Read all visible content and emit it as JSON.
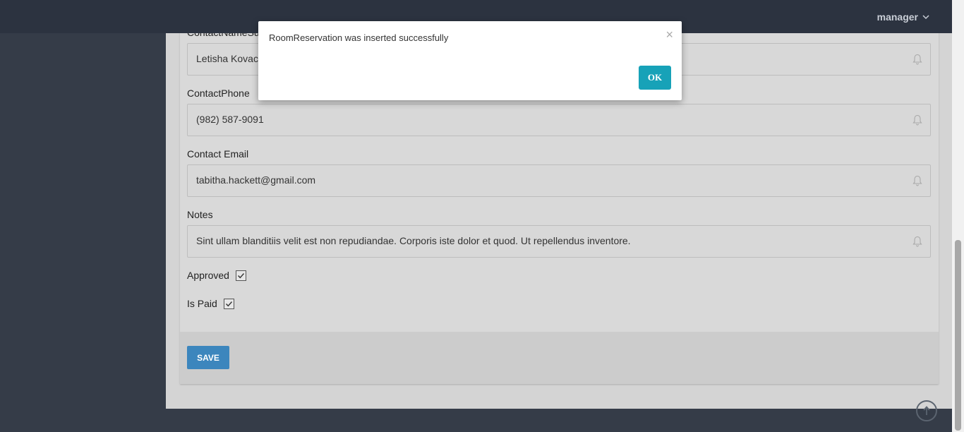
{
  "header": {
    "user_label": "manager"
  },
  "form": {
    "contact_name": {
      "label": "ContactNameSu",
      "value": "Letisha Kovac"
    },
    "contact_phone": {
      "label": "ContactPhone",
      "value": "(982) 587-9091"
    },
    "contact_email": {
      "label": "Contact Email",
      "value": "tabitha.hackett@gmail.com"
    },
    "notes": {
      "label": "Notes",
      "value": "Sint ullam blanditiis velit est non repudiandae. Corporis iste dolor et quod. Ut repellendus inventore."
    },
    "approved": {
      "label": "Approved",
      "checked": true
    },
    "is_paid": {
      "label": "Is Paid",
      "checked": true
    },
    "save_label": "SAVE"
  },
  "modal": {
    "message": "RoomReservation was inserted successfully",
    "close_glyph": "×",
    "ok_label": "OK"
  },
  "colors": {
    "accent": "#3c86bd",
    "ok": "#17a2b8",
    "sidebar": "#353c48",
    "topbar": "#2c3340"
  },
  "icons": [
    "chevron-down-icon",
    "bell-icon",
    "check-icon",
    "close-icon",
    "arrow-up-icon"
  ]
}
